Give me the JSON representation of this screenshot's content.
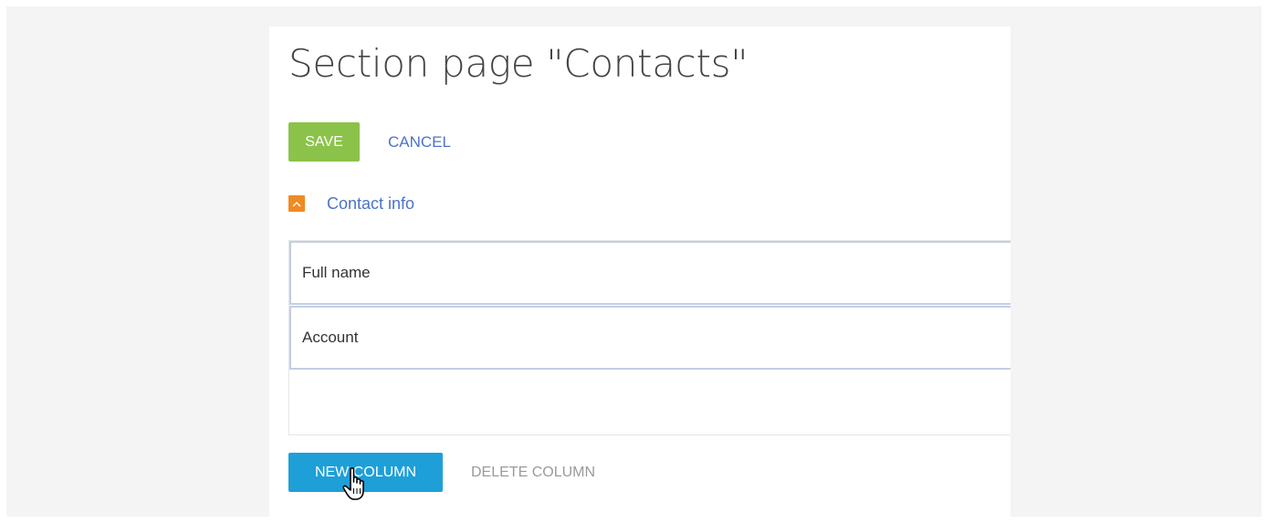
{
  "page": {
    "title": "Section page \"Contacts\""
  },
  "toolbar": {
    "save_label": "SAVE",
    "cancel_label": "CANCEL"
  },
  "group": {
    "label": "Contact info",
    "toggle_icon": "chevron-up-icon",
    "toggle_color": "#f08a24"
  },
  "columns": [
    {
      "label": "Full name"
    },
    {
      "label": "Account"
    }
  ],
  "column_actions": {
    "new_label": "NEW COLUMN",
    "delete_label": "DELETE COLUMN"
  },
  "colors": {
    "save": "#8bc34a",
    "new_column": "#1e9fd8",
    "link": "#4b73c6",
    "disabled": "#9a9a9a"
  },
  "cursor": "hand-pointer-icon"
}
